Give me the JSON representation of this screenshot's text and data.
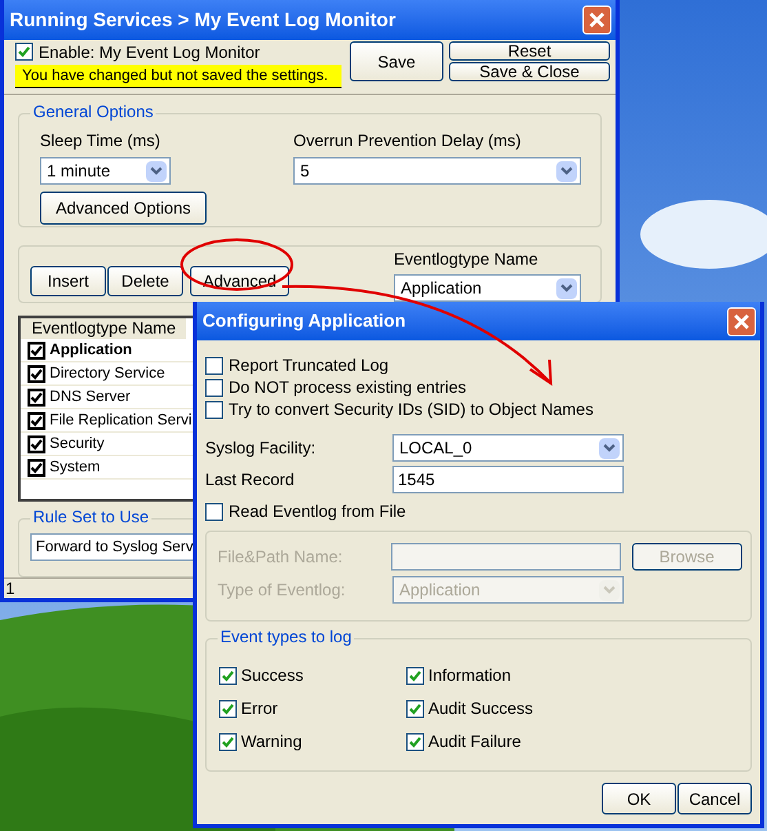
{
  "window": {
    "title": "Running Services > My Event Log Monitor"
  },
  "enable": {
    "label": "Enable: My Event Log Monitor",
    "checked": true
  },
  "warning": "You have changed but not saved the settings.",
  "save_button": "Save",
  "reset_button": "Reset",
  "save_close_button": "Save & Close",
  "general_options": {
    "title": "General Options",
    "sleep_time": {
      "label": "Sleep Time (ms)",
      "value": "1 minute"
    },
    "overrun_delay": {
      "label": "Overrun Prevention Delay (ms)",
      "value": "5"
    },
    "advanced_options_button": "Advanced Options"
  },
  "actions": {
    "buttons": [
      "Insert",
      "Delete",
      "Advanced"
    ],
    "eventlogtype": {
      "label": "Eventlogtype Name",
      "value": "Application"
    }
  },
  "eventlog_list": {
    "column": "Eventlogtype Name",
    "items": [
      {
        "label": "Application",
        "checked": true,
        "selected": true
      },
      {
        "label": "Directory Service",
        "checked": true,
        "selected": false
      },
      {
        "label": "DNS Server",
        "checked": true,
        "selected": false
      },
      {
        "label": "File Replication Servi",
        "checked": true,
        "selected": false
      },
      {
        "label": "Security",
        "checked": true,
        "selected": false
      },
      {
        "label": "System",
        "checked": true,
        "selected": false
      }
    ]
  },
  "rule_set": {
    "title": "Rule Set to Use",
    "value": "Forward to Syslog Serv"
  },
  "status_bar": "1",
  "dialog": {
    "title": "Configuring Application",
    "options": [
      {
        "label": "Report Truncated Log",
        "checked": false
      },
      {
        "label": "Do NOT process existing entries",
        "checked": false
      },
      {
        "label": "Try to convert Security IDs (SID) to Object Names",
        "checked": false
      }
    ],
    "syslog_facility": {
      "label": "Syslog Facility:",
      "value": "LOCAL_0"
    },
    "last_record": {
      "label": "Last Record",
      "value": "1545"
    },
    "read_from_file": {
      "label": "Read Eventlog from File",
      "checked": false
    },
    "file_group": {
      "disabled": true,
      "path_label": "File&Path Name:",
      "browse_button": "Browse",
      "type_label": "Type of Eventlog:",
      "type_value": "Application"
    },
    "event_types": {
      "title": "Event types to log",
      "items": [
        {
          "label": "Success",
          "checked": true
        },
        {
          "label": "Information",
          "checked": true
        },
        {
          "label": "Error",
          "checked": true
        },
        {
          "label": "Audit Success",
          "checked": true
        },
        {
          "label": "Warning",
          "checked": true
        },
        {
          "label": "Audit Failure",
          "checked": true
        }
      ]
    },
    "buttons": [
      "OK",
      "Cancel"
    ]
  }
}
